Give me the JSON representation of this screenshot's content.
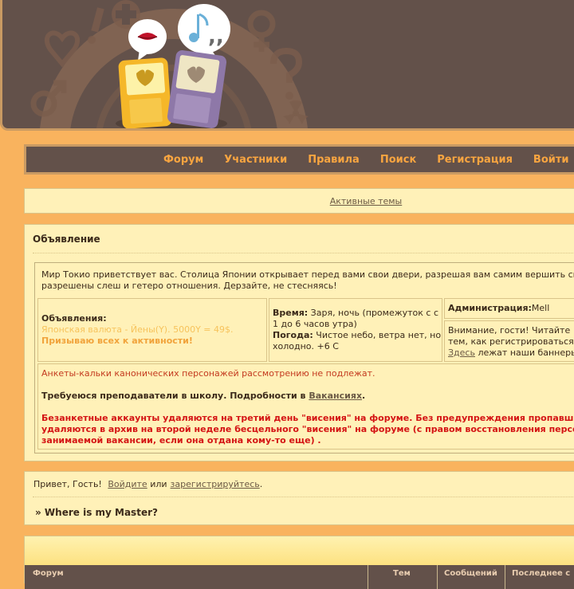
{
  "nav": {
    "items": [
      {
        "label": "Форум"
      },
      {
        "label": "Участники"
      },
      {
        "label": "Правила"
      },
      {
        "label": "Поиск"
      },
      {
        "label": "Регистрация"
      },
      {
        "label": "Войти"
      }
    ]
  },
  "active_topics": "Активные темы",
  "announcement": {
    "title": "Объявление",
    "welcome": "Мир Токио приветствует вас. Столица Японии открывает перед вами свои двери, разрешая вам самим вершить св разрешены слеш и гетеро отношения. Дерзайте, не стесняясь!",
    "ads_label": "Объявления:",
    "ads_line1": "Японская валюта - Йены(Y). 5000Y = 49$.",
    "ads_line2": "Призываю всех к активности!",
    "time_label": "Время:",
    "time_value": "Заря, ночь (промежуток с с 1 до 6 часов утра)",
    "weather_label": "Погода:",
    "weather_value": "Чистое небо, ветра нет, но холодно. +6 С",
    "admin_label": "Администрация:",
    "admin_name": "Mell",
    "guest_line1": "Внимание, гости! Читайте",
    "guest_line2": "тем, как регистрироваться",
    "guest_link": "Здесь",
    "guest_line3": "лежат наши баннеры",
    "rules_line1": "Анкеты-кальки канонических персонажей рассмотрению не подлежат.",
    "rules_line2_prefix": "Требуеюся преподаватели в школу. Подробности в",
    "rules_line2_link": "Вакансиях",
    "rules_line3": "Безанкетные аккаунты удаляются на третий день \"висения\" на форуме. Без предупреждения пропавши удаляются в архив на второй неделе бесцельного \"висения\" на форуме (с правом восстановления персо занимаемой вакансии, если она отдана кому-то еще) ."
  },
  "greeting": {
    "hello": "Привет, Гость!",
    "login": "Войдите",
    "or": "или",
    "register": "зарегистрируйтесь",
    "dot": "."
  },
  "breadcrumb": "» Where is my Master?",
  "forum_table": {
    "columns": [
      "Форум",
      "Тем",
      "Сообщений",
      "Последнее с"
    ]
  },
  "colors": {
    "background": "#f9b35e",
    "header": "#63514a",
    "panel": "#fff1b8",
    "nav_link": "#f9a540",
    "alert_red": "#d41414"
  }
}
